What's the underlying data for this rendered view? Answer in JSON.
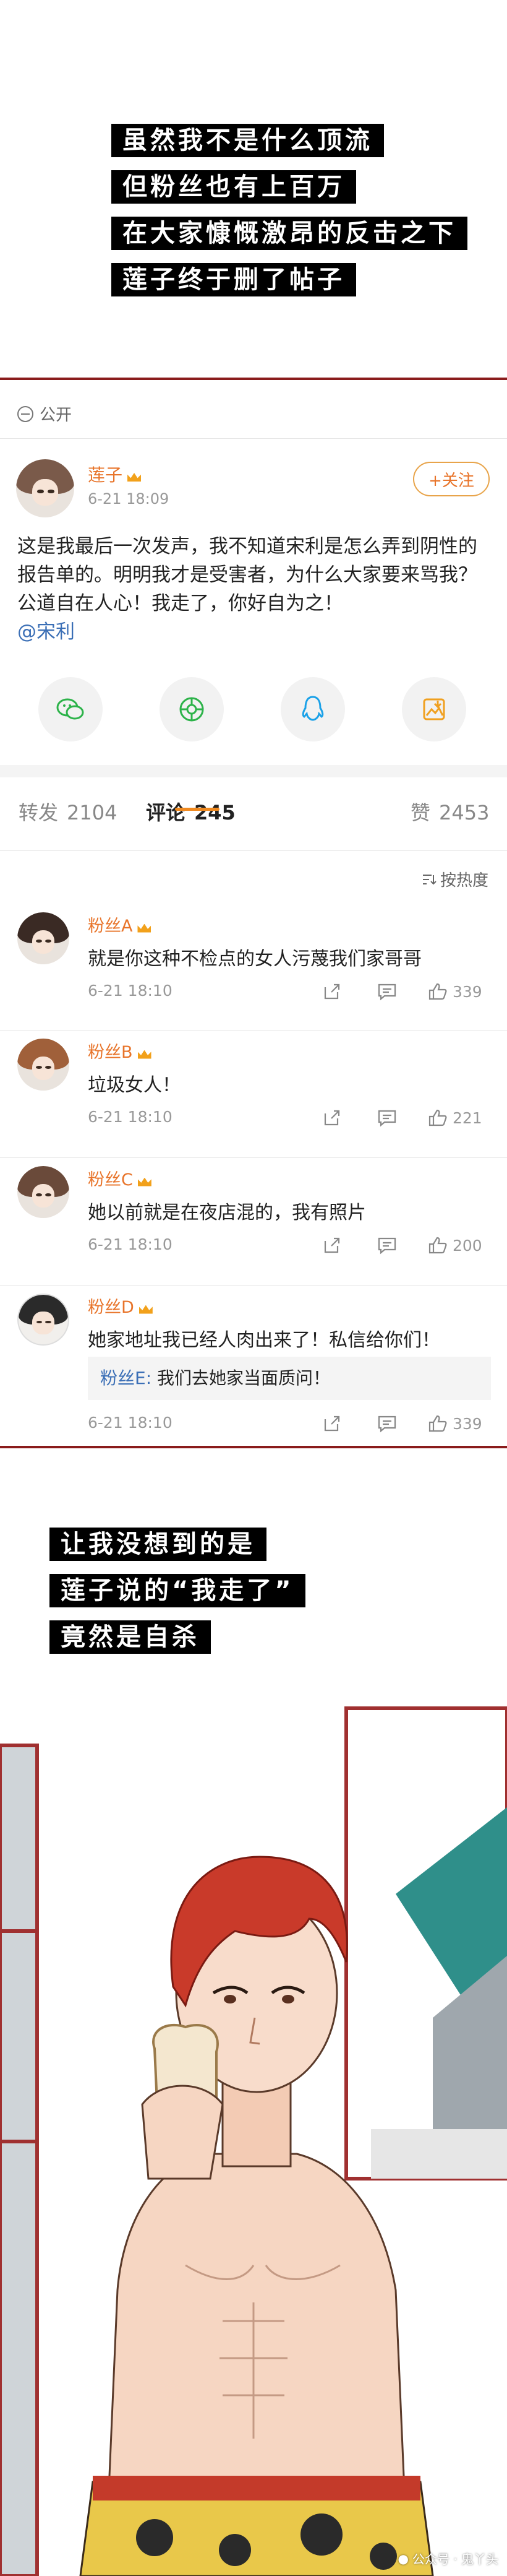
{
  "caption_top": {
    "lines": [
      "虽然我不是什么顶流",
      "但粉丝也有上百万",
      "在大家慷慨激昂的反击之下",
      "莲子终于删了帖子"
    ]
  },
  "post": {
    "visibility": "公开",
    "author": "莲子",
    "time": "6-21 18:09",
    "follow_label": "+关注",
    "text": "这是我最后一次发声，我不知道宋利是怎么弄到阴性的报告单的。明明我才是受害者，为什么大家要来骂我？公道自在人心！我走了，你好自为之！",
    "mention": "@宋利",
    "share_icons": [
      "wechat-icon",
      "moments-icon",
      "qq-icon",
      "save-image-icon"
    ]
  },
  "tabs": {
    "repost_label": "转发",
    "repost_count": "2104",
    "comment_label": "评论",
    "comment_count": "245",
    "like_label": "赞",
    "like_count": "2453"
  },
  "sort_label": "按热度",
  "comments": [
    {
      "name": "粉丝A",
      "text": "就是你这种不检点的女人污蔑我们家哥哥",
      "time": "6-21 18:10",
      "likes": "339"
    },
    {
      "name": "粉丝B",
      "text": "垃圾女人！",
      "time": "6-21 18:10",
      "likes": "221"
    },
    {
      "name": "粉丝C",
      "text": "她以前就是在夜店混的，我有照片",
      "time": "6-21 18:10",
      "likes": "200"
    },
    {
      "name": "粉丝D",
      "text": "她家地址我已经人肉出来了！私信给你们！",
      "time": "6-21 18:10",
      "likes": "339",
      "reply": {
        "name": "粉丝E:",
        "text": " 我们去她家当面质问！"
      }
    }
  ],
  "caption_bottom": {
    "lines": [
      "让我没想到的是",
      "莲子说的“我走了”",
      "竟然是自杀"
    ]
  },
  "watermark": "公众号 · 鬼丫头",
  "colors": {
    "accent": "#e8742a",
    "frame": "#8a1c1c",
    "link": "#3b6fb6",
    "tab_underline": "#f08a20"
  }
}
